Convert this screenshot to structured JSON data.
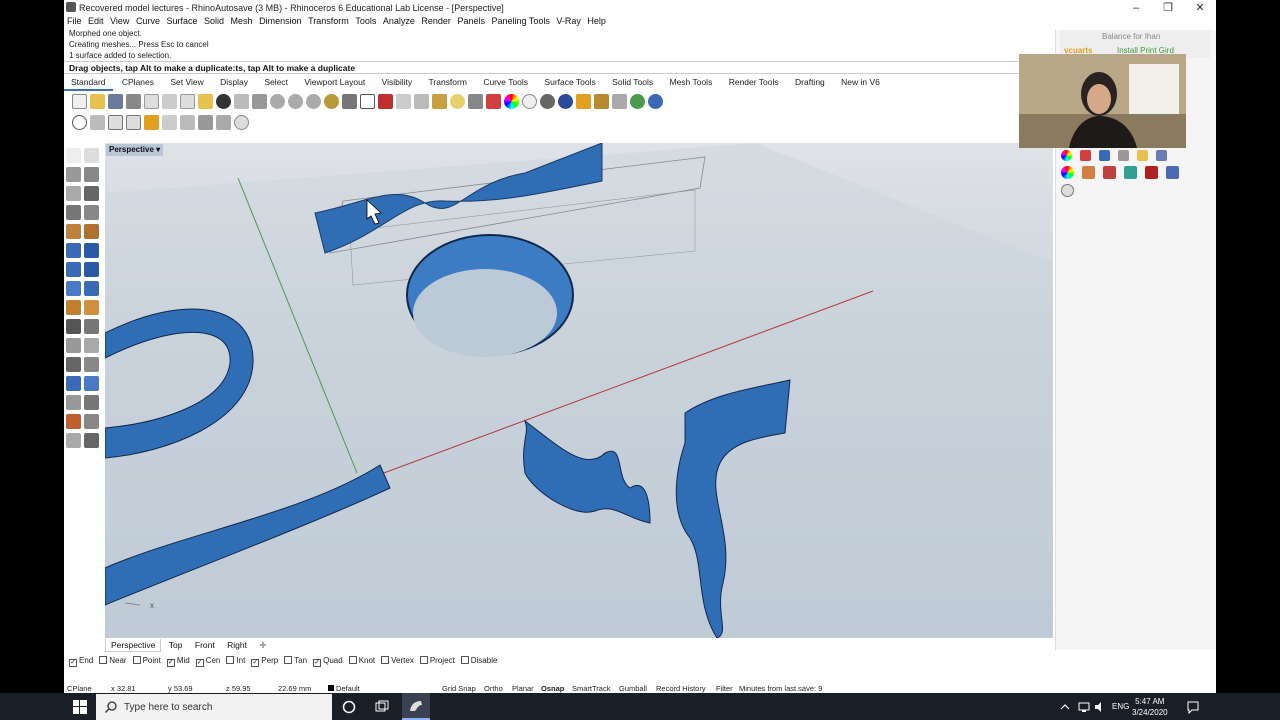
{
  "window": {
    "title": "Recovered model lectures - RhinoAutosave (3 MB) - Rhinoceros 6 Educational Lab License - [Perspective]"
  },
  "menu": [
    "File",
    "Edit",
    "View",
    "Curve",
    "Surface",
    "Solid",
    "Mesh",
    "Dimension",
    "Transform",
    "Tools",
    "Analyze",
    "Render",
    "Panels",
    "Paneling Tools",
    "V-Ray",
    "Help"
  ],
  "command_history": [
    "Morphed one object.",
    "Creating meshes... Press Esc to cancel",
    "1 surface added to selection."
  ],
  "command_prompt": "Drag objects, tap Alt to make a duplicate:ts, tap Alt to make a duplicate",
  "toolbar_tabs": [
    "Standard",
    "CPlanes",
    "Set View",
    "Display",
    "Select",
    "Viewport Layout",
    "Visibility",
    "Transform",
    "Curve Tools",
    "Surface Tools",
    "Solid Tools",
    "Mesh Tools",
    "Render Tools",
    "Drafting",
    "New in V6"
  ],
  "active_tab": "Standard",
  "viewport": {
    "title": "Perspective",
    "axis_label": "x"
  },
  "view_tabs": [
    "Perspective",
    "Top",
    "Front",
    "Right"
  ],
  "osnaps": [
    {
      "label": "End",
      "checked": true
    },
    {
      "label": "Near",
      "checked": false
    },
    {
      "label": "Point",
      "checked": false
    },
    {
      "label": "Mid",
      "checked": true
    },
    {
      "label": "Cen",
      "checked": true
    },
    {
      "label": "Int",
      "checked": false
    },
    {
      "label": "Perp",
      "checked": true
    },
    {
      "label": "Tan",
      "checked": false
    },
    {
      "label": "Quad",
      "checked": true
    },
    {
      "label": "Knot",
      "checked": false
    },
    {
      "label": "Vertex",
      "checked": false
    },
    {
      "label": "Project",
      "checked": false
    },
    {
      "label": "Disable",
      "checked": false
    }
  ],
  "status": {
    "cplane": "CPlane",
    "x": "x 32.81",
    "y": "y 53.69",
    "z": "z 59.95",
    "distance": "22.69 mm",
    "layer": "Default",
    "grid_snap": "Grid Snap",
    "ortho": "Ortho",
    "planar": "Planar",
    "osnap": "Osnap",
    "smarttrack": "SmartTrack",
    "gumball": "Gumball",
    "record_history": "Record History",
    "filter": "Filter",
    "autosave": "Minutes from last save: 9"
  },
  "right_panel": {
    "promo_title": "Balance for Ihan",
    "promo_brand": "vcuarts",
    "promo_link": "Install Print Gird"
  },
  "taskbar": {
    "search_placeholder": "Type here to search",
    "language": "ENG",
    "time": "5:47 AM",
    "date": "3/24/2020"
  },
  "colors": {
    "surface_blue": "#2f6db4",
    "viewport_top": "#dfe2e6",
    "taskbar": "#1a1e26"
  }
}
